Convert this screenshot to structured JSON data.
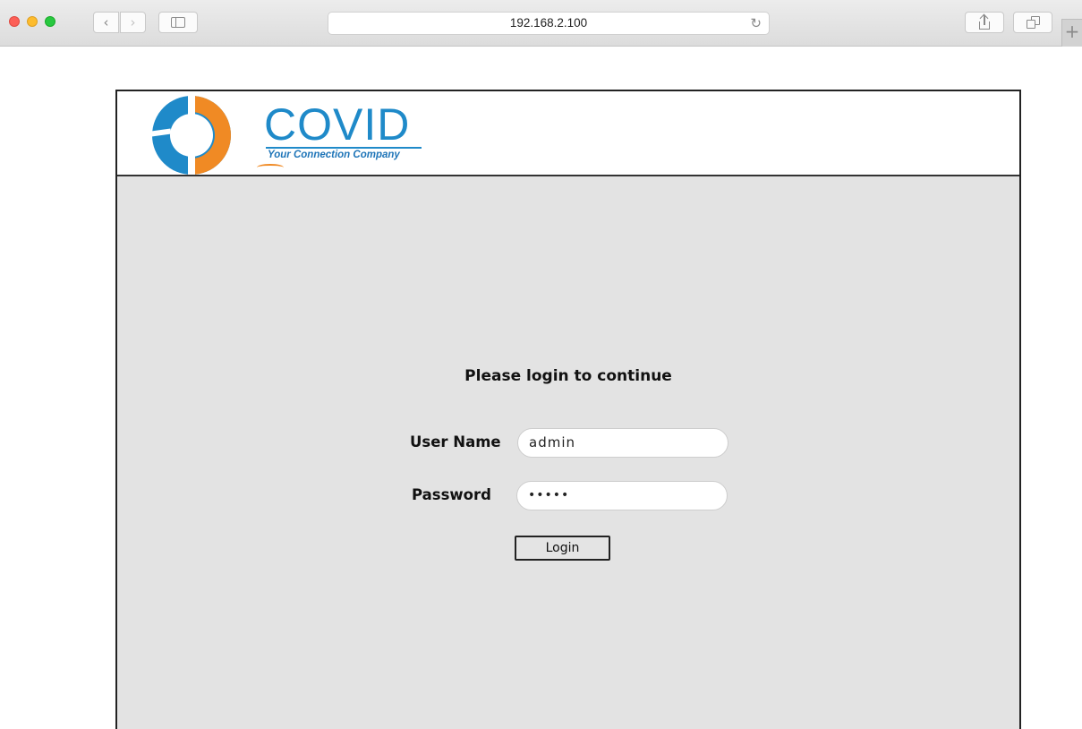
{
  "browser": {
    "url": "192.168.2.100",
    "back_glyph": "‹",
    "forward_glyph": "›",
    "reload_glyph": "↻",
    "new_tab_glyph": "+",
    "icons": [
      "back-icon",
      "forward-icon",
      "sidebar-icon",
      "reload-icon",
      "share-icon",
      "tabs-icon",
      "new-tab-icon"
    ]
  },
  "header": {
    "logo_word": "COVID",
    "logo_tagline": "Your Connection Company",
    "brand_colors": {
      "blue": "#1f8ac9",
      "orange": "#f08a24"
    }
  },
  "login": {
    "title": "Please login to continue",
    "username_label": "User Name",
    "username_value": "admin",
    "password_label": "Password",
    "password_value": "•••••",
    "button_label": "Login"
  }
}
